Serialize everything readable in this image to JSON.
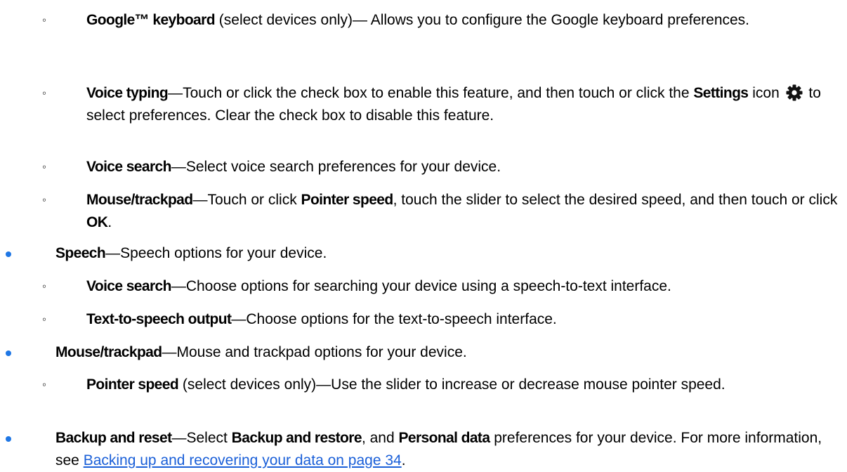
{
  "items": [
    {
      "level": 2,
      "term": "Google™ keyboard",
      "after_term": " (select devices only)— Allows you to configure the Google keyboard preferences."
    },
    {
      "level": 2,
      "term": "Voice typing",
      "text_a": "—Touch or click the check box to enable this feature, and then touch or click the ",
      "bold_b": "Settings",
      "text_c": " icon ",
      "icon": "settings-gear-icon",
      "text_d": " to select preferences. Clear the check box to disable this feature."
    },
    {
      "level": 2,
      "term": "Voice search",
      "after_term": "—Select voice search preferences for your device."
    },
    {
      "level": 2,
      "term": "Mouse/trackpad",
      "text_a": "—Touch or click ",
      "bold_b": "Pointer speed",
      "text_c": ", touch the slider to select the desired speed, and then touch or click ",
      "bold_d": "OK",
      "text_e": "."
    },
    {
      "level": 1,
      "term": "Speech",
      "after_term": "—Speech options for your device."
    },
    {
      "level": 2,
      "term": "Voice search",
      "after_term": "—Choose options for searching your device using a speech-to-text interface."
    },
    {
      "level": 2,
      "term": "Text-to-speech output",
      "after_term": "—Choose options for the text-to-speech interface."
    },
    {
      "level": 1,
      "term": "Mouse/trackpad",
      "after_term": "—Mouse and trackpad options for your device."
    },
    {
      "level": 2,
      "term": "Pointer speed",
      "after_term": " (select devices only)—Use the slider to increase or decrease mouse pointer speed."
    },
    {
      "level": 1,
      "term": "Backup and reset",
      "text_a": "—Select ",
      "bold_b": "Backup and restore",
      "text_c": ", and ",
      "bold_d": "Personal data",
      "text_e": " preferences for your device. For more information, see ",
      "link": "Backing up and recovering your data on page 34",
      "text_f": "."
    }
  ],
  "colors": {
    "bullet": "#1f77e5",
    "link": "#1a5fd8",
    "text": "#000000",
    "gear_icon": "#111111"
  },
  "markers": {
    "level1": "filled-circle-bullet",
    "level2": "◦"
  }
}
